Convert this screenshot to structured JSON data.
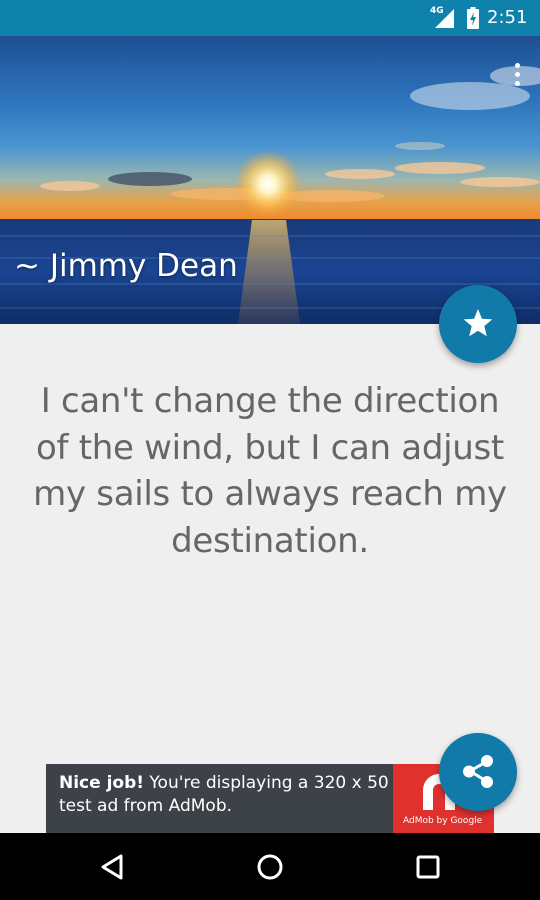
{
  "status_bar": {
    "network_label": "4G",
    "time": "2:51",
    "background_color": "#0f82ab"
  },
  "header": {
    "author": "~ Jimmy Dean",
    "image_description_icon": "sunset-ocean-image"
  },
  "quote": {
    "text": "I can't change the direction of the wind, but I can adjust my sails to always reach my destination."
  },
  "ad": {
    "bold_text": "Nice job!",
    "body_text": " You're displaying a 320 x 50 test ad from AdMob.",
    "logo_caption": "AdMob by Google"
  },
  "fab": {
    "favorite_icon": "star-icon",
    "share_icon": "share-icon",
    "color": "#117aa8"
  },
  "nav_bar": {
    "back_icon": "back-triangle-icon",
    "home_icon": "home-circle-icon",
    "recents_icon": "recents-square-icon"
  }
}
